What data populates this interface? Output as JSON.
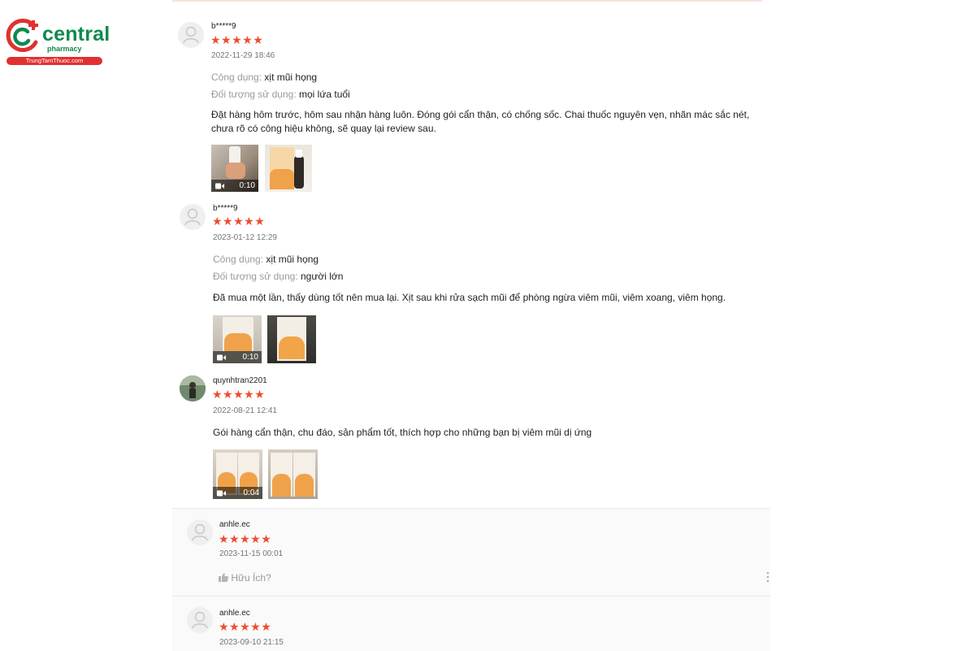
{
  "brand": {
    "name": "central",
    "tagline": "pharmacy",
    "url": "TrungTamThuoc.com"
  },
  "reviews": [
    {
      "username": "b*****9",
      "stars": "★★★★★",
      "date": "2022-11-29 18:46",
      "use_label": "Công dụng:",
      "use_value": "xịt mũi họng",
      "target_label": "Đối tượng sử dụng:",
      "target_value": "mọi lứa tuổi",
      "text": "Đặt hàng hôm trước, hôm sau nhận hàng luôn. Đóng gói cẩn thận, có chống sốc. Chai thuốc nguyên vẹn, nhãn mác sắc nét, chưa rõ có công hiệu không, sẽ quay lại review sau.",
      "video_duration": "0:10"
    },
    {
      "username": "b*****9",
      "stars": "★★★★★",
      "date": "2023-01-12 12:29",
      "use_label": "Công dụng:",
      "use_value": "xịt mũi họng",
      "target_label": "Đối tượng sử dụng:",
      "target_value": "người lớn",
      "text": "Đã mua một lần, thấy dùng tốt nên mua lại. Xịt sau khi rửa sạch mũi để phòng ngừa viêm mũi, viêm xoang, viêm họng.",
      "video_duration": "0:10"
    },
    {
      "username": "quynhtran2201",
      "stars": "★★★★★",
      "date": "2022-08-21 12:41",
      "text": "Gói hàng cẩn thận, chu đáo, sản phẩm tốt, thích hợp cho những bạn bị viêm mũi dị ứng",
      "video_duration": "0:04"
    },
    {
      "username": "anhle.ec",
      "stars": "★★★★★",
      "date": "2023-11-15 00:01",
      "helpful_label": "Hữu Ích?"
    },
    {
      "username": "anhle.ec",
      "stars": "★★★★★",
      "date": "2023-09-10 21:15"
    }
  ],
  "colors": {
    "star": "#ee4d2d",
    "brand_green": "#0f8a4f",
    "brand_red": "#e03131"
  }
}
